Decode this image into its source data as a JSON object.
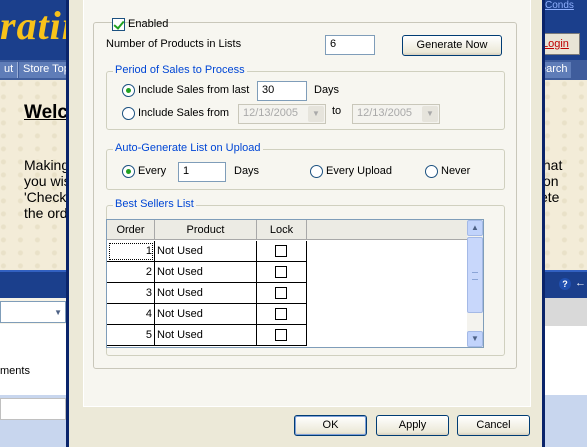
{
  "background": {
    "logo_text": "ratin",
    "top_link": "Conds",
    "login_label": "Login",
    "nav": [
      "ut",
      "Store Top"
    ],
    "search_label": "earch",
    "welcome": "Welc",
    "para_left": [
      "Making",
      "you wis",
      "'Check",
      "the ord"
    ],
    "para_right": [
      "that",
      "on",
      "ete"
    ],
    "help_icon": "?",
    "pin_icon": "←",
    "side_text": "ments"
  },
  "dialog": {
    "enabled_label": "Enabled",
    "enabled_checked": true,
    "num_products_label": "Number of Products in Lists",
    "num_products_value": "6",
    "generate_now_label": "Generate Now",
    "period_group": {
      "title": "Period of Sales to Process",
      "include_last_label": "Include Sales from last",
      "include_last_value": "30",
      "days_label": "Days",
      "include_from_label": "Include Sales from",
      "from_date": "12/13/2005",
      "to_label": "to",
      "to_date": "12/13/2005",
      "selected": "last"
    },
    "auto_group": {
      "title": "Auto-Generate List on Upload",
      "every_label": "Every",
      "every_value": "1",
      "days_label": "Days",
      "every_upload_label": "Every Upload",
      "never_label": "Never",
      "selected": "every"
    },
    "best_sellers": {
      "title": "Best Sellers List",
      "columns": [
        "Order",
        "Product",
        "Lock"
      ],
      "rows": [
        {
          "order": "1",
          "product": "Not Used",
          "lock": false
        },
        {
          "order": "2",
          "product": "Not Used",
          "lock": false
        },
        {
          "order": "3",
          "product": "Not Used",
          "lock": false
        },
        {
          "order": "4",
          "product": "Not Used",
          "lock": false
        },
        {
          "order": "5",
          "product": "Not Used",
          "lock": false
        }
      ]
    },
    "buttons": {
      "ok": "OK",
      "apply": "Apply",
      "cancel": "Cancel"
    }
  }
}
